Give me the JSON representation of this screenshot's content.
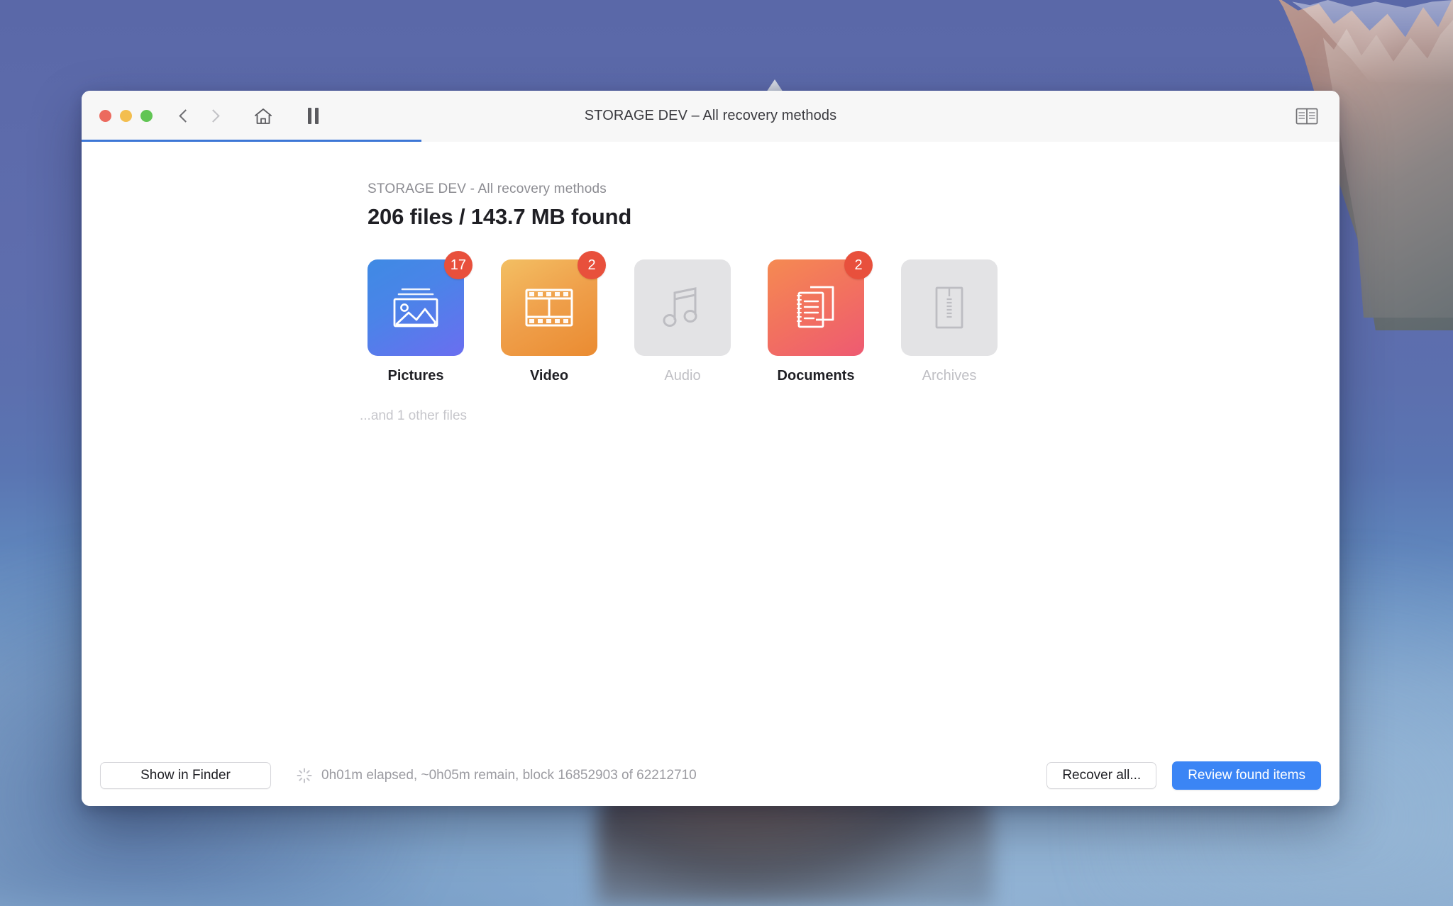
{
  "window": {
    "title": "STORAGE DEV – All recovery methods",
    "traffic_lights": [
      "close",
      "minimize",
      "zoom"
    ],
    "toolbar": {
      "back_label": "Back",
      "forward_label": "Forward",
      "home_label": "Home",
      "pause_label": "Pause",
      "log_label": "Log"
    },
    "progress_percent": 27
  },
  "content": {
    "subheading": "STORAGE DEV - All recovery methods",
    "heading": "206 files / 143.7 MB found",
    "other_files_note": "...and 1 other files",
    "tiles": [
      {
        "label": "Pictures",
        "badge": "17",
        "icon": "image-icon",
        "enabled": true,
        "theme": "pictures"
      },
      {
        "label": "Video",
        "badge": "2",
        "icon": "film-icon",
        "enabled": true,
        "theme": "video"
      },
      {
        "label": "Audio",
        "badge": "",
        "icon": "music-icon",
        "enabled": false,
        "theme": "disabled"
      },
      {
        "label": "Documents",
        "badge": "2",
        "icon": "documents-icon",
        "enabled": true,
        "theme": "documents"
      },
      {
        "label": "Archives",
        "badge": "",
        "icon": "archive-icon",
        "enabled": false,
        "theme": "disabled"
      }
    ]
  },
  "footer": {
    "show_in_finder": "Show in Finder",
    "status": "0h01m elapsed, ~0h05m remain, block 16852903 of 62212710",
    "recover_all": "Recover all...",
    "review_found": "Review found items"
  },
  "colors": {
    "accent_blue": "#3b85f5",
    "progress_blue": "#3d77d6",
    "badge_red": "#e8503c",
    "tile_disabled": "#e3e3e5"
  }
}
